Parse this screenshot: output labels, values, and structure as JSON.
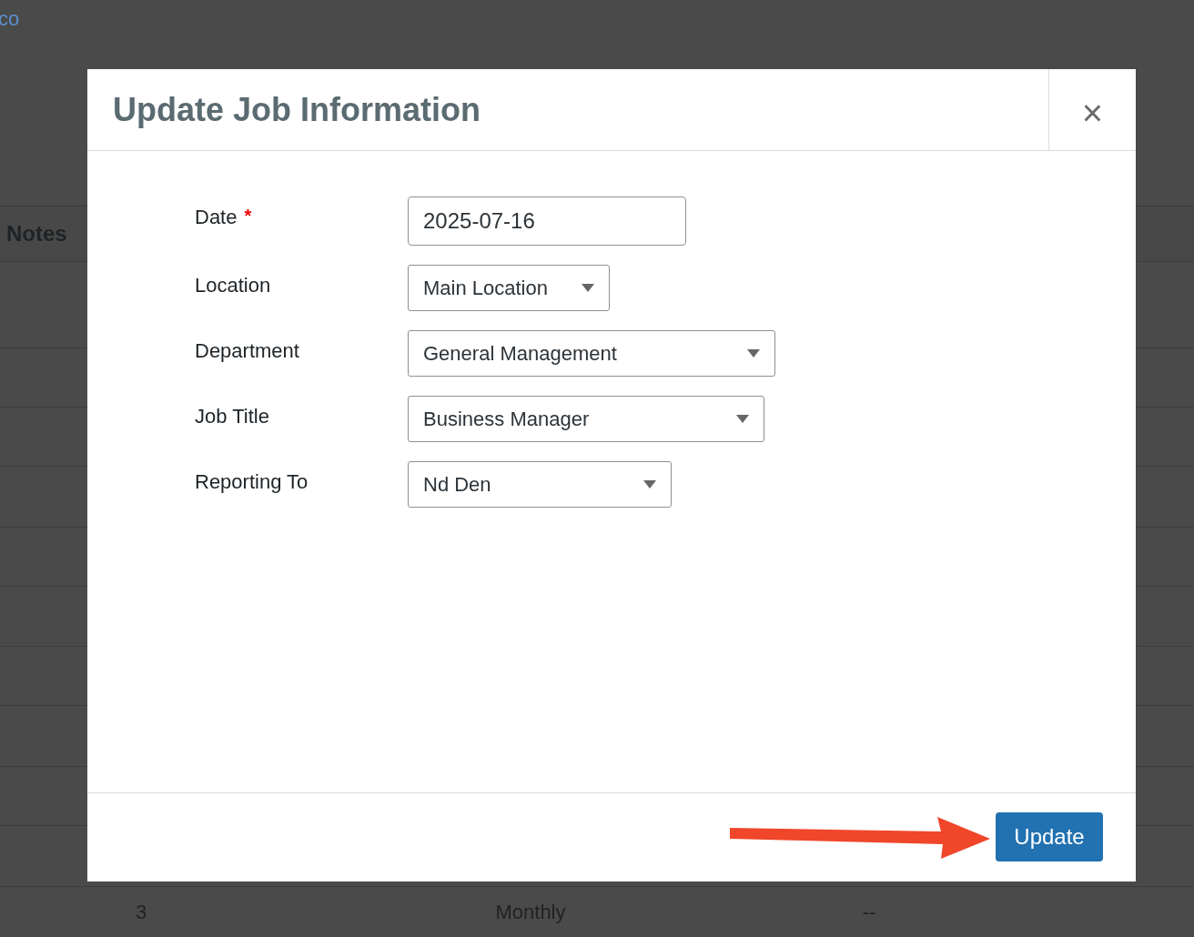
{
  "background": {
    "link": "co",
    "table": {
      "column_heading": "Notes",
      "row": [
        "3",
        "Monthly",
        "--"
      ]
    }
  },
  "dialog": {
    "title": "Update Job Information",
    "close": "×",
    "fields": [
      {
        "label": "Date",
        "required": true,
        "kind": "text",
        "value": "2025-07-16"
      },
      {
        "label": "Location",
        "required": false,
        "kind": "select",
        "value": "Main Location"
      },
      {
        "label": "Department",
        "required": false,
        "kind": "select",
        "value": "General Management"
      },
      {
        "label": "Job Title",
        "required": false,
        "kind": "select",
        "value": "Business Manager"
      },
      {
        "label": "Reporting To",
        "required": false,
        "kind": "select",
        "value": "Nd Den"
      }
    ],
    "required_mark": "*",
    "button": "Update"
  }
}
